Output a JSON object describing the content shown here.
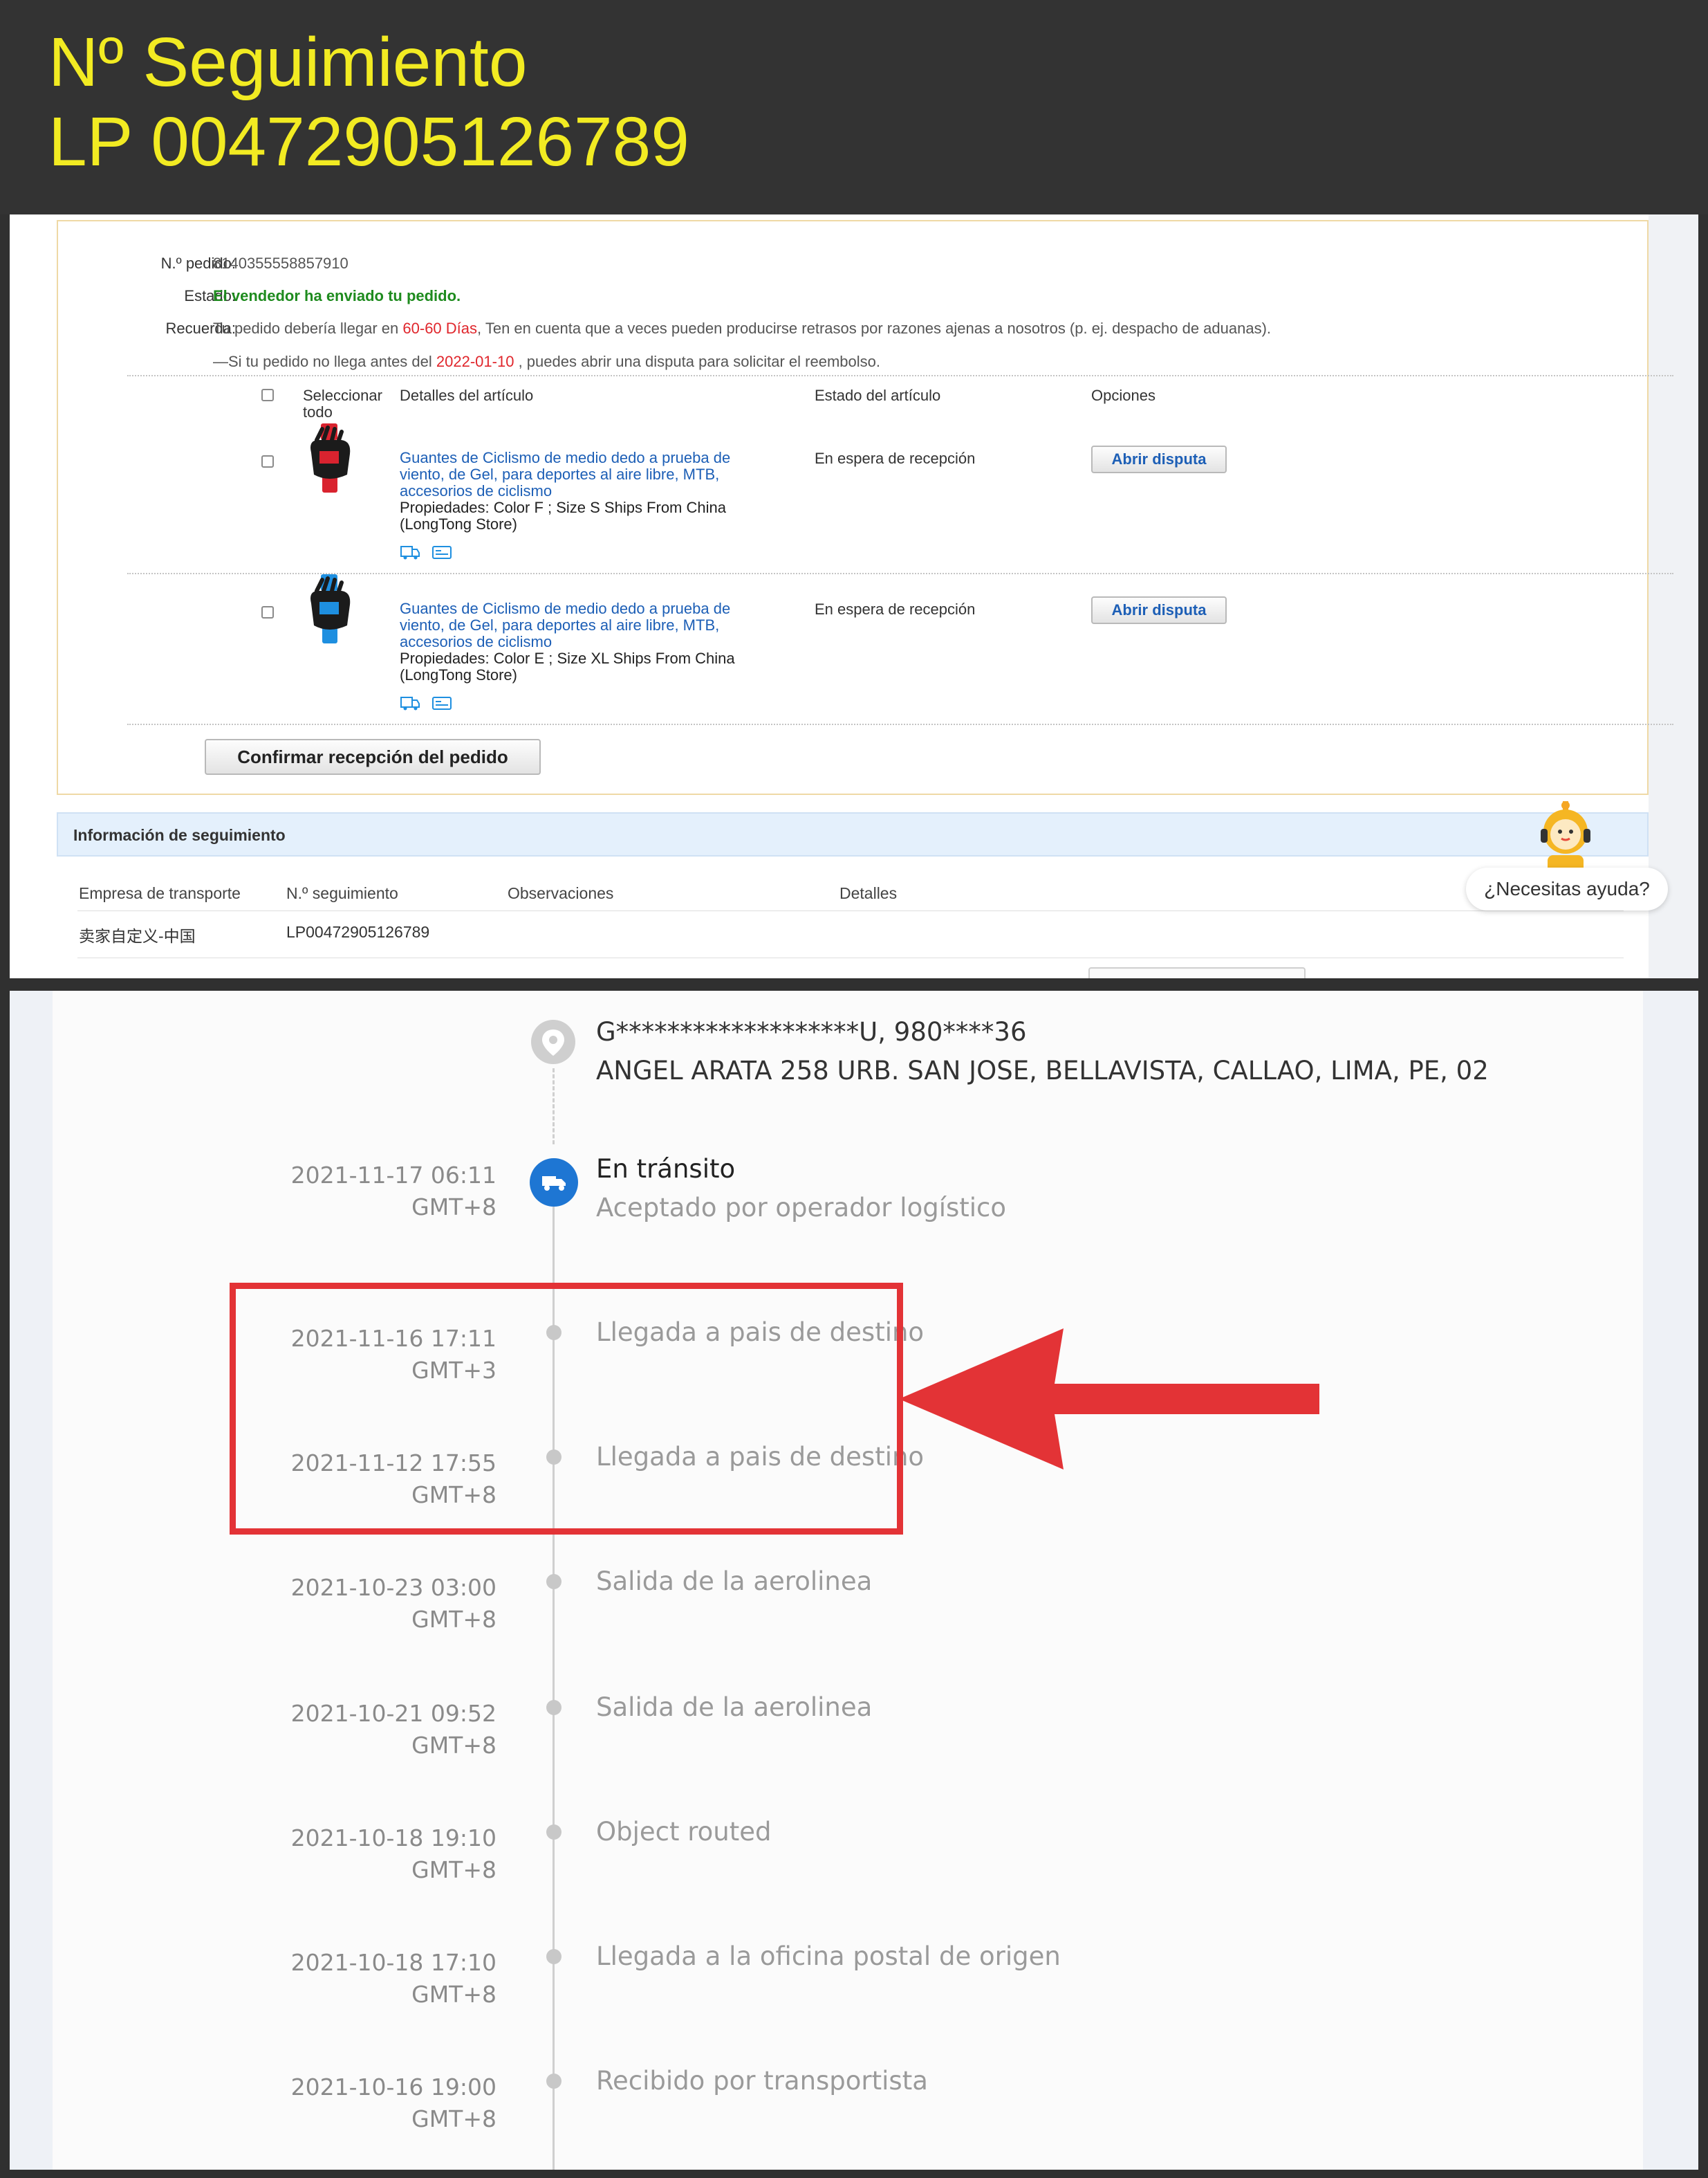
{
  "banner": {
    "line1": "Nº Seguimiento",
    "line2": "LP 00472905126789",
    "text_color": "#f2eb22"
  },
  "order": {
    "order_no_label": "N.º pedido:",
    "order_no_value": "8140355558857910",
    "status_label": "Estado:",
    "status_value": "El vendedor ha enviado tu pedido.",
    "reminder_label": "Recuerda:",
    "reminder_part1": "Tu pedido debería llegar en",
    "reminder_days": "60-60 Días",
    "reminder_part2": ", Ten en cuenta que a veces pueden producirse retrasos por razones ajenas a nosotros (p. ej. despacho de aduanas).",
    "dispute_part1": "—Si tu pedido no llega antes del",
    "dispute_date": "2022-01-10",
    "dispute_part2": ", puedes abrir una disputa para solicitar el reembolso.",
    "columns": {
      "select_all": "Seleccionar todo",
      "details": "Detalles del artículo",
      "state": "Estado del artículo",
      "options": "Opciones"
    },
    "items": [
      {
        "title": "Guantes de Ciclismo de medio dedo a prueba de viento, de Gel, para deportes al aire libre, MTB, accesorios de ciclismo",
        "props": "Propiedades: Color F   ; Size S Ships From China (LongTong Store)",
        "state": "En espera de recepción",
        "action": "Abrir disputa",
        "color": "#d9232f"
      },
      {
        "title": "Guantes de Ciclismo de medio dedo a prueba de viento, de Gel, para deportes al aire libre, MTB, accesorios de ciclismo",
        "props": "Propiedades: Color E   ; Size XL Ships From China (LongTong Store)",
        "state": "En espera de recepción",
        "action": "Abrir disputa",
        "color": "#1e8fe0"
      }
    ],
    "confirm_button": "Confirmar recepción del pedido"
  },
  "tracking_info": {
    "header": "Información de seguimiento",
    "columns": {
      "carrier": "Empresa de transporte",
      "tracking_no": "N.º seguimiento",
      "notes": "Observaciones",
      "details": "Detalles"
    },
    "row": {
      "carrier": "卖家自定义-中国",
      "tracking_no": "LP00472905126789"
    },
    "help": "¿Necesitas ayuda?"
  },
  "timeline": {
    "recipient_name": "G*******************U,  980****36",
    "recipient_address": "ANGEL ARATA 258 URB. SAN JOSE, BELLAVISTA,  CALLAO,  LIMA,  PE,  02",
    "current": {
      "time": "2021-11-17 06:11",
      "tz": "GMT+8",
      "title": "En tránsito",
      "subtitle": "Aceptado por operador logístico"
    },
    "events": [
      {
        "time": "2021-11-16 17:11",
        "tz": "GMT+3",
        "title": "Llegada a pais de destino"
      },
      {
        "time": "2021-11-12 17:55",
        "tz": "GMT+8",
        "title": "Llegada a pais de destino"
      },
      {
        "time": "2021-10-23 03:00",
        "tz": "GMT+8",
        "title": "Salida de la aerolinea"
      },
      {
        "time": "2021-10-21 09:52",
        "tz": "GMT+8",
        "title": "Salida de la aerolinea"
      },
      {
        "time": "2021-10-18 19:10",
        "tz": "GMT+8",
        "title": "Object routed"
      },
      {
        "time": "2021-10-18 17:10",
        "tz": "GMT+8",
        "title": "Llegada a la oficina postal de origen"
      },
      {
        "time": "2021-10-16 19:00",
        "tz": "GMT+8",
        "title": "Recibido por transportista"
      }
    ],
    "accent_color": "#1e76d3",
    "highlight_color": "#e33336"
  }
}
